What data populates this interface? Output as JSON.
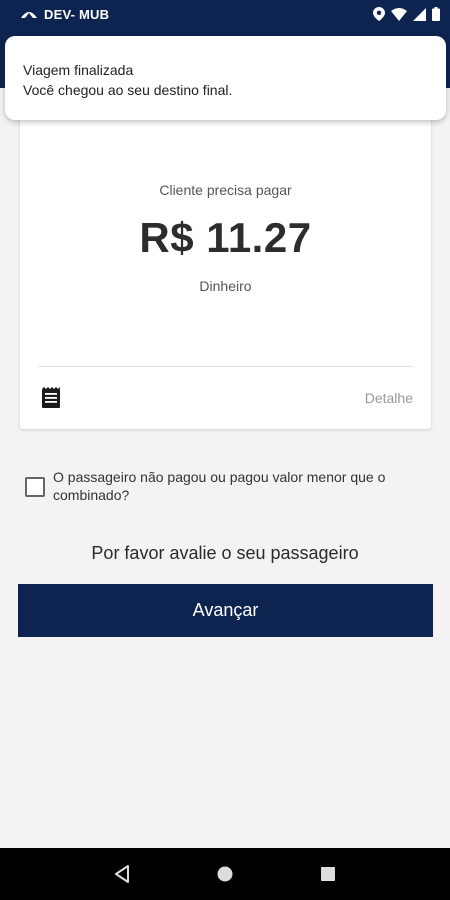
{
  "status_bar": {
    "app_name": "DEV- MUB",
    "icons": [
      "location-icon",
      "wifi-icon",
      "signal-icon",
      "battery-icon"
    ]
  },
  "notification": {
    "title": "Viagem finalizada",
    "body": "Você chegou ao seu destino final."
  },
  "payment_card": {
    "label": "Cliente precisa pagar",
    "amount": "R$ 11.27",
    "method": "Dinheiro",
    "detail_link": "Detalhe",
    "icon": "receipt-icon"
  },
  "unpaid_checkbox": {
    "label": "O passageiro não pagou ou pagou valor menor que o combinado?",
    "checked": false
  },
  "rating_prompt": "Por favor avalie o seu passageiro",
  "advance_button": "Avançar",
  "colors": {
    "primary": "#0e2450",
    "background": "#f4f2f3"
  },
  "navigation": [
    "back-icon",
    "home-icon",
    "recents-icon"
  ]
}
